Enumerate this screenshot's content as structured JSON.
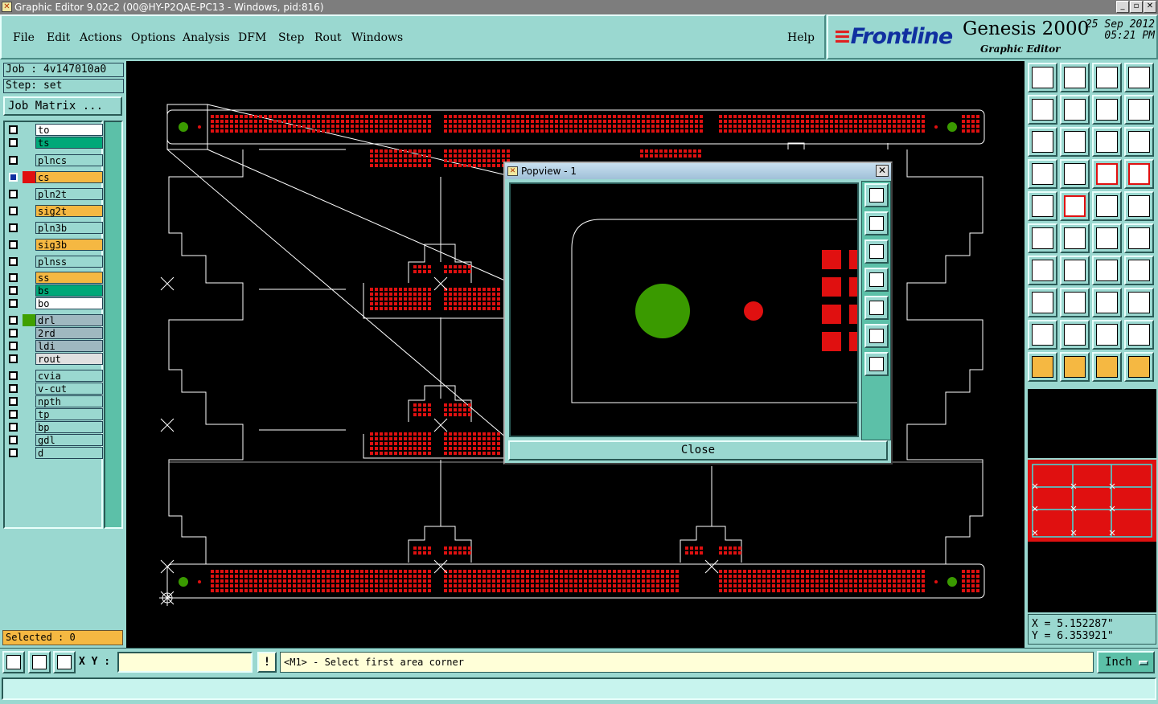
{
  "window": {
    "title": "Graphic Editor 9.02c2 (00@HY-P2QAE-PC13 - Windows, pid:816)"
  },
  "menu": {
    "items": [
      {
        "label": "File"
      },
      {
        "label": "Edit"
      },
      {
        "label": "Actions"
      },
      {
        "label": "Options"
      },
      {
        "label": "Analysis"
      },
      {
        "label": "DFM"
      },
      {
        "label": "Step"
      },
      {
        "label": "Rout"
      },
      {
        "label": "Windows"
      }
    ],
    "help": "Help"
  },
  "brand": {
    "logo": "Frontline",
    "product": "Genesis 2000",
    "subtitle": "Graphic Editor",
    "date": "25 Sep 2012",
    "time": "05:21 PM"
  },
  "job": {
    "job_line": "Job : 4v147010a0",
    "step_line": "Step: set",
    "matrix_button": "Job Matrix ..."
  },
  "layers": [
    {
      "name": "to",
      "color": "#ffffff",
      "swatch": "",
      "active": false
    },
    {
      "name": "ts",
      "color": "#00a878",
      "swatch": "",
      "active": false
    },
    {
      "name": "plncs",
      "color": "#9ad8d0",
      "swatch": "",
      "active": false
    },
    {
      "name": "cs",
      "color": "#f5b842",
      "swatch": "#e01010",
      "active": true
    },
    {
      "name": "pln2t",
      "color": "#9ad8d0",
      "swatch": "",
      "active": false
    },
    {
      "name": "sig2t",
      "color": "#f5b842",
      "swatch": "",
      "active": false
    },
    {
      "name": "pln3b",
      "color": "#9ad8d0",
      "swatch": "",
      "active": false
    },
    {
      "name": "sig3b",
      "color": "#f5b842",
      "swatch": "",
      "active": false
    },
    {
      "name": "plnss",
      "color": "#9ad8d0",
      "swatch": "",
      "active": false
    },
    {
      "name": "ss",
      "color": "#f5b842",
      "swatch": "",
      "active": false
    },
    {
      "name": "bs",
      "color": "#00a878",
      "swatch": "",
      "active": false
    },
    {
      "name": "bo",
      "color": "#ffffff",
      "swatch": "",
      "active": false
    },
    {
      "name": "drl",
      "color": "#9fb8c0",
      "swatch": "#40a000",
      "active": false
    },
    {
      "name": "2rd",
      "color": "#9fb8c0",
      "swatch": "",
      "active": false
    },
    {
      "name": "ldi",
      "color": "#9fb8c0",
      "swatch": "",
      "active": false
    },
    {
      "name": "rout",
      "color": "#e0e0e0",
      "swatch": "",
      "active": false
    },
    {
      "name": "cvia",
      "color": "#9ad8d0",
      "swatch": "",
      "active": false
    },
    {
      "name": "v-cut",
      "color": "#9ad8d0",
      "swatch": "",
      "active": false
    },
    {
      "name": "npth",
      "color": "#9ad8d0",
      "swatch": "",
      "active": false
    },
    {
      "name": "tp",
      "color": "#9ad8d0",
      "swatch": "",
      "active": false
    },
    {
      "name": "bp",
      "color": "#9ad8d0",
      "swatch": "",
      "active": false
    },
    {
      "name": "gdl",
      "color": "#9ad8d0",
      "swatch": "",
      "active": false
    },
    {
      "name": "d",
      "color": "#9ad8d0",
      "swatch": "",
      "active": false
    }
  ],
  "selected": "Selected : 0",
  "popview": {
    "title": "Popview - 1",
    "close_x": "✕",
    "close_button": "Close"
  },
  "coords": {
    "x": "X = 5.152287\"",
    "y": "Y = 6.353921\""
  },
  "command": {
    "xy_label": "X Y :",
    "xy_value": "",
    "excl": "!",
    "prompt": "<M1> - Select first area corner",
    "units": "Inch"
  },
  "status": "",
  "colors": {
    "panel": "#9ad8d0",
    "pad": "#e01010",
    "drill": "#3a9a00",
    "accent": "#f5b842"
  }
}
